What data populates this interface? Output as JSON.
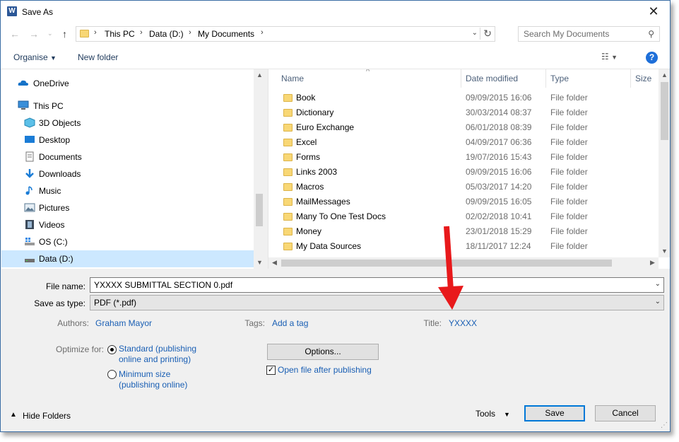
{
  "window": {
    "title": "Save As",
    "app_icon": "W"
  },
  "address": {
    "breadcrumbs": [
      "This PC",
      "Data (D:)",
      "My Documents"
    ],
    "search_placeholder": "Search My Documents"
  },
  "toolbar": {
    "organise": "Organise",
    "new_folder": "New folder"
  },
  "nav": {
    "items": [
      {
        "label": "OneDrive",
        "icon": "onedrive-cloud-icon"
      },
      {
        "label": "This PC",
        "icon": "computer-icon"
      },
      {
        "label": "3D Objects",
        "icon": "3d-objects-icon"
      },
      {
        "label": "Desktop",
        "icon": "desktop-icon"
      },
      {
        "label": "Documents",
        "icon": "documents-icon"
      },
      {
        "label": "Downloads",
        "icon": "downloads-icon"
      },
      {
        "label": "Music",
        "icon": "music-icon"
      },
      {
        "label": "Pictures",
        "icon": "pictures-icon"
      },
      {
        "label": "Videos",
        "icon": "videos-icon"
      },
      {
        "label": "OS (C:)",
        "icon": "drive-c-icon"
      },
      {
        "label": "Data (D:)",
        "icon": "drive-d-icon",
        "selected": true
      }
    ]
  },
  "files": {
    "columns": [
      "Name",
      "Date modified",
      "Type",
      "Size"
    ],
    "rows": [
      {
        "name": "Book",
        "date": "09/09/2015 16:06",
        "type": "File folder"
      },
      {
        "name": "Dictionary",
        "date": "30/03/2014 08:37",
        "type": "File folder"
      },
      {
        "name": "Euro Exchange",
        "date": "06/01/2018 08:39",
        "type": "File folder"
      },
      {
        "name": "Excel",
        "date": "04/09/2017 06:36",
        "type": "File folder"
      },
      {
        "name": "Forms",
        "date": "19/07/2016 15:43",
        "type": "File folder"
      },
      {
        "name": "Links 2003",
        "date": "09/09/2015 16:06",
        "type": "File folder"
      },
      {
        "name": "Macros",
        "date": "05/03/2017 14:20",
        "type": "File folder"
      },
      {
        "name": "MailMessages",
        "date": "09/09/2015 16:05",
        "type": "File folder"
      },
      {
        "name": "Many To One Test Docs",
        "date": "02/02/2018 10:41",
        "type": "File folder"
      },
      {
        "name": "Money",
        "date": "23/01/2018 15:29",
        "type": "File folder"
      },
      {
        "name": "My Data Sources",
        "date": "18/11/2017 12:24",
        "type": "File folder"
      }
    ]
  },
  "form": {
    "file_name_label": "File name:",
    "file_name_value": "YXXXX SUBMITTAL SECTION 0.pdf",
    "save_type_label": "Save as type:",
    "save_type_value": "PDF (*.pdf)",
    "authors_label": "Authors:",
    "authors_value": "Graham Mayor",
    "tags_label": "Tags:",
    "tags_value": "Add a tag",
    "title_label": "Title:",
    "title_value": "YXXXX",
    "optimize_label": "Optimize for:",
    "opt_standard_line1": "Standard (publishing",
    "opt_standard_line2": "online and printing)",
    "opt_minimum_line1": "Minimum size",
    "opt_minimum_line2": "(publishing online)",
    "options_button": "Options...",
    "open_after_label": "Open file after publishing"
  },
  "footer": {
    "hide_folders": "Hide Folders",
    "tools": "Tools",
    "save": "Save",
    "cancel": "Cancel"
  },
  "colors": {
    "accent": "#0078d7",
    "selection": "#cce8ff",
    "link": "#1a5fb4",
    "annotation_arrow": "#e8191b"
  }
}
